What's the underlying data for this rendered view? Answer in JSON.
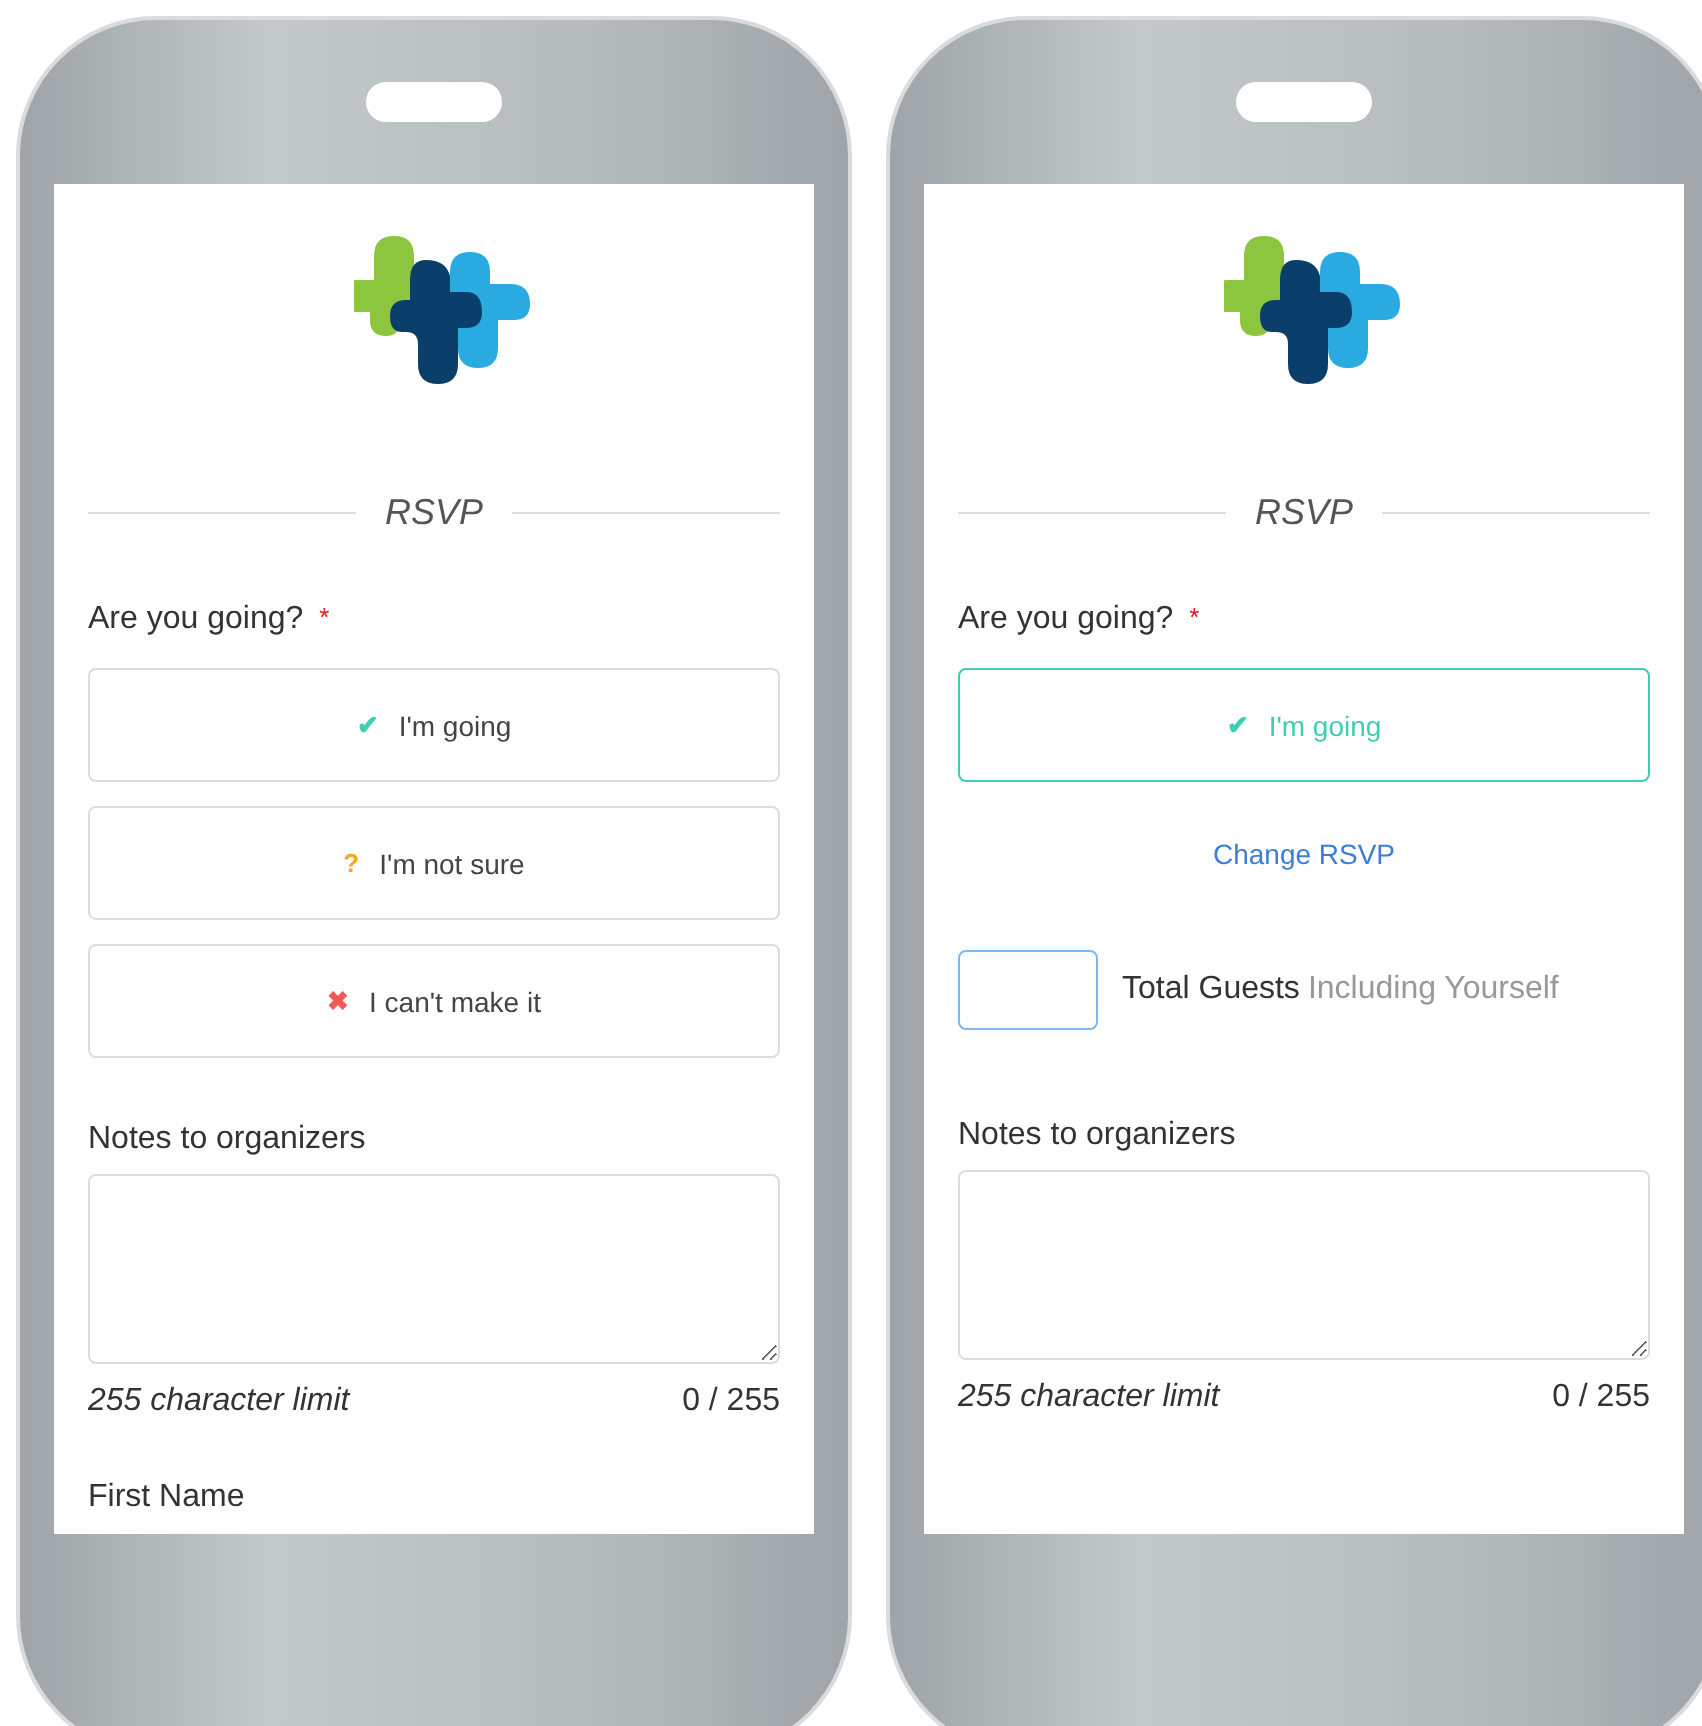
{
  "phones": [
    {
      "title": "RSVP",
      "question": "Are you going?",
      "required_mark": "*",
      "options": [
        {
          "symbol": "✔",
          "label": "I'm going",
          "color": "#3ecfb2",
          "selected": false
        },
        {
          "symbol": "?",
          "label": "I'm not sure",
          "color": "#f5a623",
          "selected": false
        },
        {
          "symbol": "✖",
          "label": "I can't make it",
          "color": "#f05a5a",
          "selected": false
        }
      ],
      "notes": {
        "label": "Notes to organizers",
        "limit_note": "255 character limit",
        "counter": "0 / 255"
      },
      "next_field": {
        "label": "First Name"
      }
    },
    {
      "title": "RSVP",
      "question": "Are you going?",
      "required_mark": "*",
      "options": [
        {
          "symbol": "✔",
          "label": "I'm going",
          "color": "#3ecfb2",
          "selected": true
        }
      ],
      "change_link": "Change RSVP",
      "guests": {
        "label": "Total Guests",
        "hint": "Including Yourself"
      },
      "notes": {
        "label": "Notes to organizers",
        "limit_note": "255 character limit",
        "counter": "0 / 255"
      }
    }
  ]
}
